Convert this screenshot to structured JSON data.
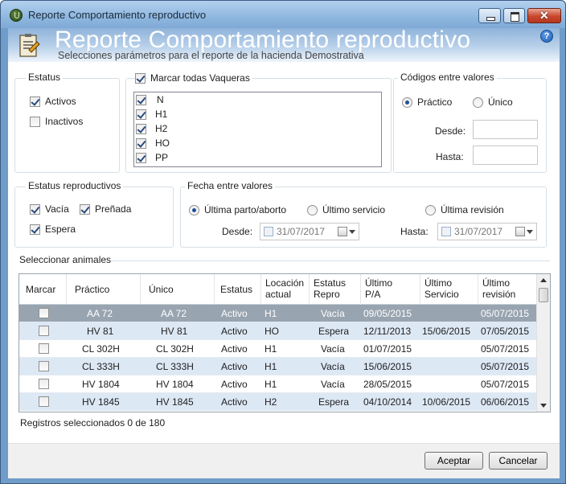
{
  "window": {
    "title": "Reporte Comportamiento reproductivo",
    "close_glyph": "✕"
  },
  "header": {
    "title": "Reporte Comportamiento reproductivo",
    "subtitle": "Selecciones parámetros para el reporte de la hacienda Demostrativa",
    "help_glyph": "?"
  },
  "estatus": {
    "title": "Estatus",
    "options": [
      {
        "label": "Activos",
        "checked": true
      },
      {
        "label": "Inactivos",
        "checked": false
      }
    ]
  },
  "vaqueras": {
    "mark_all_label": "Marcar todas Vaqueras",
    "mark_all_checked": true,
    "items": [
      {
        "label": "N",
        "checked": true
      },
      {
        "label": "H1",
        "checked": true
      },
      {
        "label": "H2",
        "checked": true
      },
      {
        "label": "HO",
        "checked": true
      },
      {
        "label": "PP",
        "checked": true
      }
    ]
  },
  "codigos": {
    "title": "Códigos entre valores",
    "options": [
      {
        "label": "Práctico",
        "selected": true
      },
      {
        "label": "Único",
        "selected": false
      }
    ],
    "desde_label": "Desde:",
    "desde_value": "",
    "hasta_label": "Hasta:",
    "hasta_value": ""
  },
  "estatus_repro": {
    "title": "Estatus reproductivos",
    "options": [
      {
        "label": "Vacía",
        "checked": true
      },
      {
        "label": "Preñada",
        "checked": true
      },
      {
        "label": "Espera",
        "checked": true
      }
    ]
  },
  "fecha": {
    "title": "Fecha entre valores",
    "options": [
      {
        "label": "Última parto/aborto",
        "selected": true
      },
      {
        "label": "Último servicio",
        "selected": false
      },
      {
        "label": "Última revisión",
        "selected": false
      }
    ],
    "desde_label": "Desde:",
    "desde_value": "31/07/2017",
    "hasta_label": "Hasta:",
    "hasta_value": "31/07/2017"
  },
  "animales": {
    "title": "Seleccionar animales",
    "columns": [
      {
        "l1": "Marcar",
        "l2": ""
      },
      {
        "l1": "Práctico",
        "l2": ""
      },
      {
        "l1": "Único",
        "l2": ""
      },
      {
        "l1": "Estatus",
        "l2": ""
      },
      {
        "l1": "Locación",
        "l2": "actual"
      },
      {
        "l1": "Estatus",
        "l2": "Repro"
      },
      {
        "l1": "Último",
        "l2": "P/A"
      },
      {
        "l1": "Último",
        "l2": "Servicio"
      },
      {
        "l1": "Último",
        "l2": "revisión"
      }
    ],
    "rows": [
      {
        "checked": false,
        "practico": "AA 72",
        "unico": "AA 72",
        "estatus": "Activo",
        "locacion": "H1",
        "repro": "Vacía",
        "pa": "09/05/2015",
        "servicio": "",
        "revision": "05/07/2015"
      },
      {
        "checked": false,
        "practico": "HV 81",
        "unico": "HV 81",
        "estatus": "Activo",
        "locacion": "HO",
        "repro": "Espera",
        "pa": "12/11/2013",
        "servicio": "15/06/2015",
        "revision": "07/05/2015"
      },
      {
        "checked": false,
        "practico": "CL 302H",
        "unico": "CL 302H",
        "estatus": "Activo",
        "locacion": "H1",
        "repro": "Vacía",
        "pa": "01/07/2015",
        "servicio": "",
        "revision": "05/07/2015"
      },
      {
        "checked": false,
        "practico": "CL 333H",
        "unico": "CL 333H",
        "estatus": "Activo",
        "locacion": "H1",
        "repro": "Vacía",
        "pa": "15/06/2015",
        "servicio": "",
        "revision": "05/07/2015"
      },
      {
        "checked": false,
        "practico": "HV 1804",
        "unico": "HV 1804",
        "estatus": "Activo",
        "locacion": "H1",
        "repro": "Vacía",
        "pa": "28/05/2015",
        "servicio": "",
        "revision": "05/07/2015"
      },
      {
        "checked": false,
        "practico": "HV 1845",
        "unico": "HV 1845",
        "estatus": "Activo",
        "locacion": "H2",
        "repro": "Espera",
        "pa": "04/10/2014",
        "servicio": "10/06/2015",
        "revision": "06/06/2015"
      }
    ],
    "status_text": "Registros seleccionados 0 de 180"
  },
  "buttons": {
    "accept": "Aceptar",
    "cancel": "Cancelar"
  },
  "colors": {
    "selected_row": "#98a4b0",
    "alt_row": "#dde8f5",
    "header_gradient_top": "#8fb3da"
  }
}
